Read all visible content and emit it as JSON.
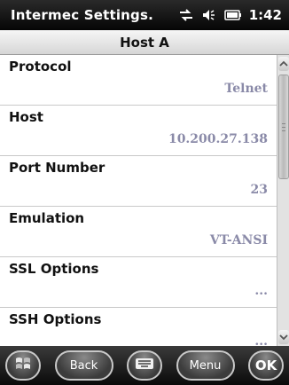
{
  "statusbar": {
    "app_title": "Intermec Settings.",
    "time": "1:42",
    "icons": [
      "connectivity-icon",
      "volume-icon",
      "battery-icon"
    ]
  },
  "title": "Host A",
  "settings": [
    {
      "label": "Protocol",
      "value": "Telnet"
    },
    {
      "label": "Host",
      "value": "10.200.27.138"
    },
    {
      "label": "Port Number",
      "value": "23"
    },
    {
      "label": "Emulation",
      "value": "VT-ANSI"
    },
    {
      "label": "SSL Options",
      "value": "..."
    },
    {
      "label": "SSH Options",
      "value": "..."
    }
  ],
  "softkeys": {
    "start_icon": "windows-start-icon",
    "back_label": "Back",
    "keyboard_icon": "keyboard-icon",
    "menu_label": "Menu",
    "ok_label": "OK"
  }
}
